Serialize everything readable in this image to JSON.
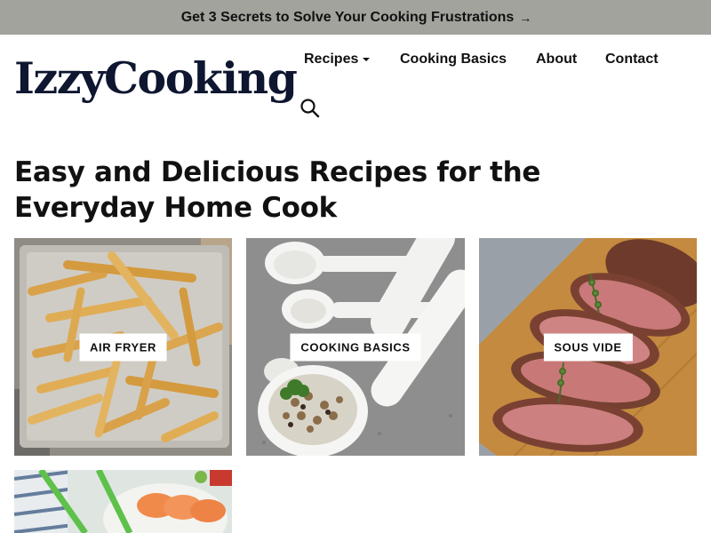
{
  "promo": {
    "text": "Get 3 Secrets to Solve Your Cooking Frustrations",
    "arrow": "→"
  },
  "brand": {
    "logo": "IzzyCooking",
    "color": "#0e1630"
  },
  "nav": {
    "items": [
      {
        "label": "Recipes",
        "has_dropdown": true
      },
      {
        "label": "Cooking Basics"
      },
      {
        "label": "About"
      },
      {
        "label": "Contact"
      }
    ],
    "search_icon": "search-icon"
  },
  "headline": "Easy and Delicious Recipes for the Everyday Home Cook",
  "categories": [
    {
      "label": "AIR FRYER",
      "image": "french-fries-on-tray"
    },
    {
      "label": "COOKING BASICS",
      "image": "measuring-spoons-with-rice"
    },
    {
      "label": "SOUS VIDE",
      "image": "sliced-roast-beef"
    },
    {
      "label": "",
      "image": "sushi-with-chopsticks"
    }
  ],
  "colors": {
    "promo_bg": "#a1a39c",
    "text": "#111111"
  }
}
